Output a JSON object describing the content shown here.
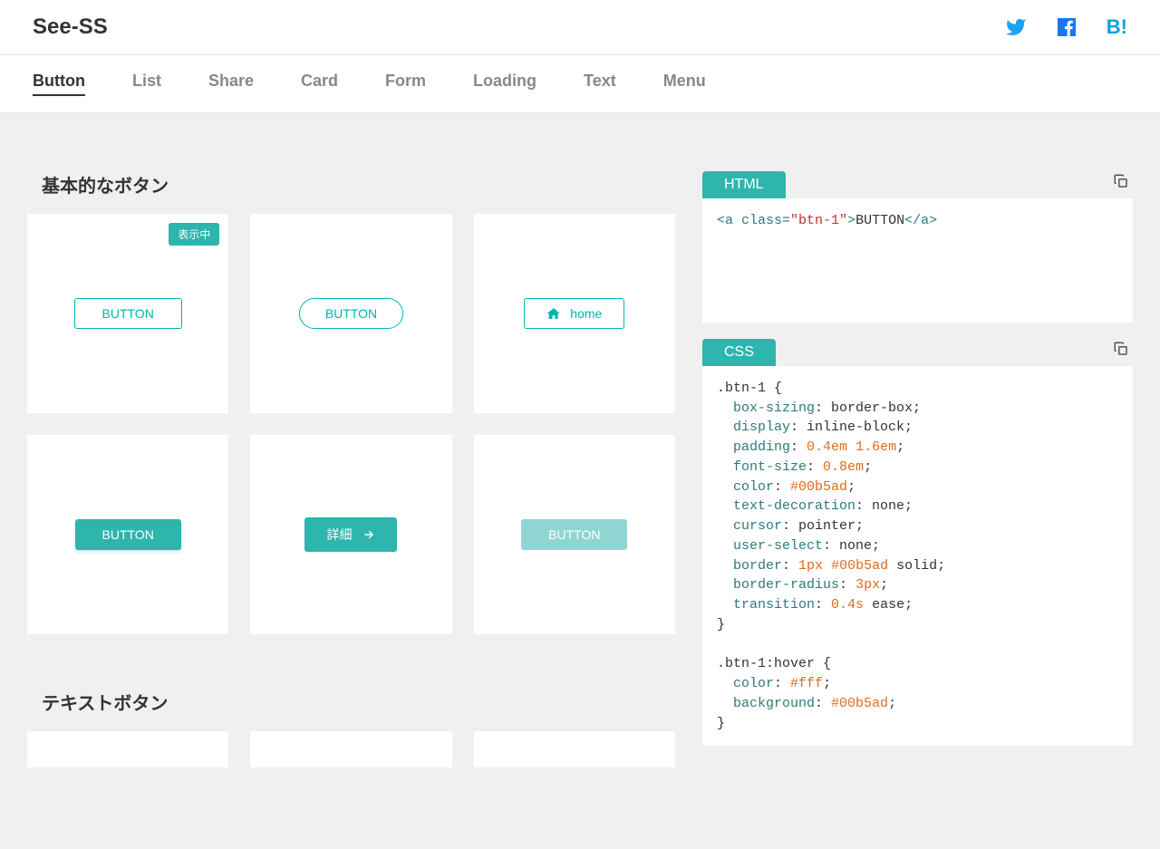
{
  "logo": "See-SS",
  "nav": {
    "items": [
      "Button",
      "List",
      "Share",
      "Card",
      "Form",
      "Loading",
      "Text",
      "Menu"
    ],
    "active": 0
  },
  "sections": {
    "basic": {
      "title": "基本的なボタン",
      "badge": "表示中"
    },
    "text": {
      "title": "テキストボタン"
    }
  },
  "buttons": {
    "b1": "BUTTON",
    "b2": "BUTTON",
    "b3": "home",
    "b4": "BUTTON",
    "b5": "詳細",
    "b6": "BUTTON"
  },
  "code": {
    "html": {
      "label": "HTML"
    },
    "css": {
      "label": "CSS"
    }
  }
}
